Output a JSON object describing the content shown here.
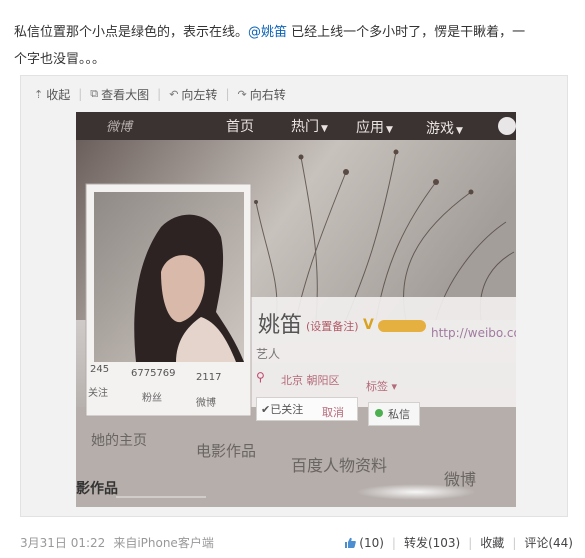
{
  "post": {
    "text_a": "私信位置那个小点是绿色的，表示在线。",
    "mention": "@姚笛",
    "text_b": " 已经上线一个多小时了，愣是干瞅着，一",
    "text_c": "个字也没冒。。。"
  },
  "toolbar": {
    "collapse": "收起",
    "view_large": "查看大图",
    "rotate_left": "向左转",
    "rotate_right": "向右转"
  },
  "photo": {
    "nav_logo": "微博",
    "nav_home": "首页",
    "nav_hot": "热门",
    "nav_apps": "应用",
    "nav_games": "游戏",
    "stats": [
      {
        "value": "245",
        "label": "关注"
      },
      {
        "value": "6775769",
        "label": "粉丝"
      },
      {
        "value": "2117",
        "label": "微博"
      }
    ],
    "profile_name": "姚笛",
    "set_remark": "(设置备注)",
    "profile_url": "http://weibo.co",
    "profile_role": "艺人",
    "location": "北京 朝阳区",
    "tag": "标签",
    "followed": "已关注",
    "unfollow": "取消",
    "message": "私信",
    "tabs": [
      "她的主页",
      "电影作品",
      "百度人物资料",
      "微博"
    ],
    "bottom_cut": "影作品"
  },
  "footer": {
    "timestamp": "3月31日 01:22",
    "source": "来自iPhone客户端",
    "like": "(10)",
    "repost": "转发(103)",
    "favorite": "收藏",
    "comment": "评论(44)"
  },
  "colors": {
    "mention": "#0a62b8",
    "online_dot": "#4caf50"
  }
}
